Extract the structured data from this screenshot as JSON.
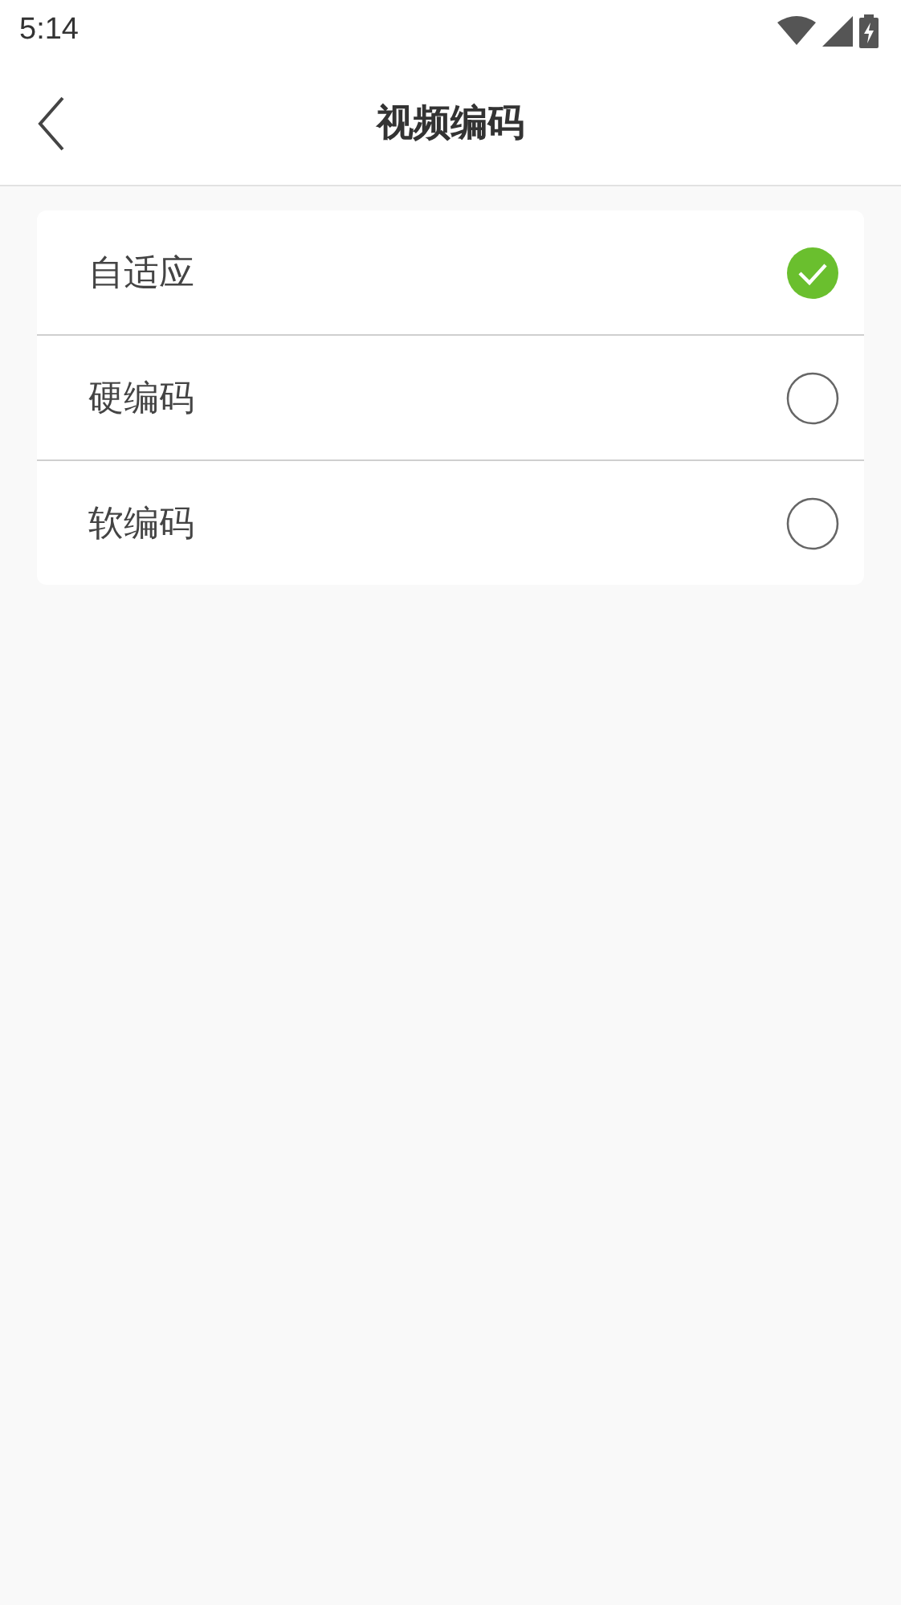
{
  "status_bar": {
    "time": "5:14"
  },
  "header": {
    "title": "视频编码"
  },
  "options": [
    {
      "label": "自适应",
      "selected": true
    },
    {
      "label": "硬编码",
      "selected": false
    },
    {
      "label": "软编码",
      "selected": false
    }
  ]
}
